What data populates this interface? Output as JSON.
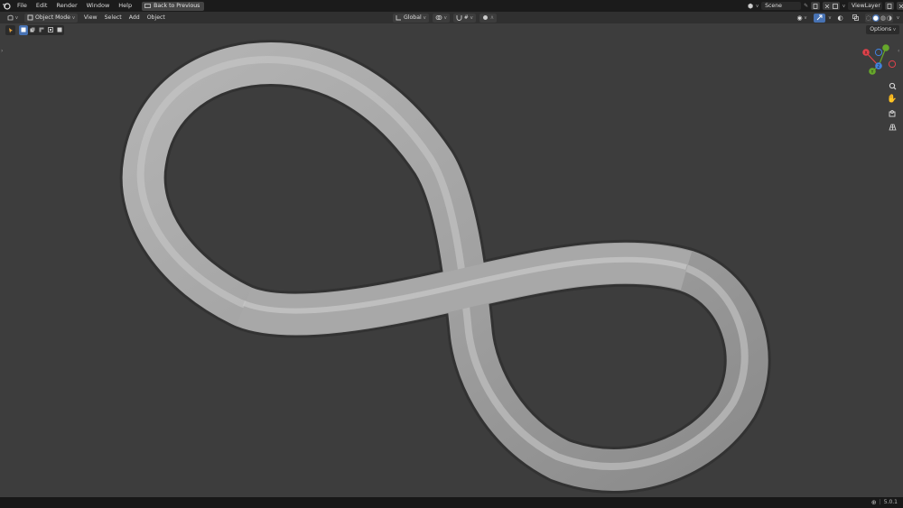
{
  "menubar": {
    "items": [
      "File",
      "Edit",
      "Render",
      "Window",
      "Help"
    ],
    "back_button": "Back to Previous",
    "scene": "Scene",
    "view_layer": "ViewLayer"
  },
  "header": {
    "mode": "Object Mode",
    "menus": [
      "View",
      "Select",
      "Add",
      "Object"
    ],
    "orientation": "Global"
  },
  "toolbar": {
    "options_label": "Options"
  },
  "gizmo": {
    "x_label": "X",
    "y_label": "Y",
    "z_label": "Z",
    "colors": {
      "x": "#e0424b",
      "y": "#67a82b",
      "z": "#4283e0"
    }
  },
  "viewport": {
    "background": "#3d3d3d",
    "object_color": "#9a9a9a"
  },
  "status": {
    "version": "5.0.1"
  }
}
